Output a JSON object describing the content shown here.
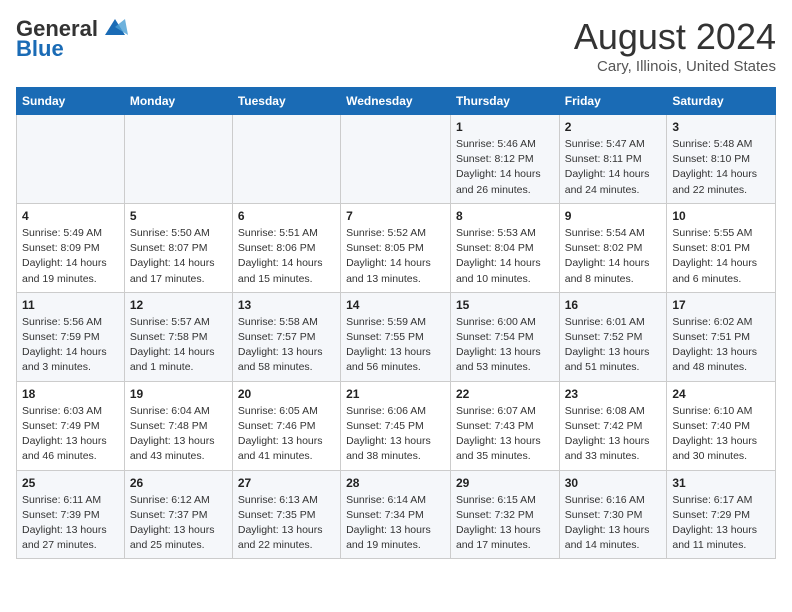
{
  "header": {
    "logo_line1": "General",
    "logo_line2": "Blue",
    "month": "August 2024",
    "location": "Cary, Illinois, United States"
  },
  "weekdays": [
    "Sunday",
    "Monday",
    "Tuesday",
    "Wednesday",
    "Thursday",
    "Friday",
    "Saturday"
  ],
  "weeks": [
    [
      {
        "day": "",
        "info": ""
      },
      {
        "day": "",
        "info": ""
      },
      {
        "day": "",
        "info": ""
      },
      {
        "day": "",
        "info": ""
      },
      {
        "day": "1",
        "info": "Sunrise: 5:46 AM\nSunset: 8:12 PM\nDaylight: 14 hours\nand 26 minutes."
      },
      {
        "day": "2",
        "info": "Sunrise: 5:47 AM\nSunset: 8:11 PM\nDaylight: 14 hours\nand 24 minutes."
      },
      {
        "day": "3",
        "info": "Sunrise: 5:48 AM\nSunset: 8:10 PM\nDaylight: 14 hours\nand 22 minutes."
      }
    ],
    [
      {
        "day": "4",
        "info": "Sunrise: 5:49 AM\nSunset: 8:09 PM\nDaylight: 14 hours\nand 19 minutes."
      },
      {
        "day": "5",
        "info": "Sunrise: 5:50 AM\nSunset: 8:07 PM\nDaylight: 14 hours\nand 17 minutes."
      },
      {
        "day": "6",
        "info": "Sunrise: 5:51 AM\nSunset: 8:06 PM\nDaylight: 14 hours\nand 15 minutes."
      },
      {
        "day": "7",
        "info": "Sunrise: 5:52 AM\nSunset: 8:05 PM\nDaylight: 14 hours\nand 13 minutes."
      },
      {
        "day": "8",
        "info": "Sunrise: 5:53 AM\nSunset: 8:04 PM\nDaylight: 14 hours\nand 10 minutes."
      },
      {
        "day": "9",
        "info": "Sunrise: 5:54 AM\nSunset: 8:02 PM\nDaylight: 14 hours\nand 8 minutes."
      },
      {
        "day": "10",
        "info": "Sunrise: 5:55 AM\nSunset: 8:01 PM\nDaylight: 14 hours\nand 6 minutes."
      }
    ],
    [
      {
        "day": "11",
        "info": "Sunrise: 5:56 AM\nSunset: 7:59 PM\nDaylight: 14 hours\nand 3 minutes."
      },
      {
        "day": "12",
        "info": "Sunrise: 5:57 AM\nSunset: 7:58 PM\nDaylight: 14 hours\nand 1 minute."
      },
      {
        "day": "13",
        "info": "Sunrise: 5:58 AM\nSunset: 7:57 PM\nDaylight: 13 hours\nand 58 minutes."
      },
      {
        "day": "14",
        "info": "Sunrise: 5:59 AM\nSunset: 7:55 PM\nDaylight: 13 hours\nand 56 minutes."
      },
      {
        "day": "15",
        "info": "Sunrise: 6:00 AM\nSunset: 7:54 PM\nDaylight: 13 hours\nand 53 minutes."
      },
      {
        "day": "16",
        "info": "Sunrise: 6:01 AM\nSunset: 7:52 PM\nDaylight: 13 hours\nand 51 minutes."
      },
      {
        "day": "17",
        "info": "Sunrise: 6:02 AM\nSunset: 7:51 PM\nDaylight: 13 hours\nand 48 minutes."
      }
    ],
    [
      {
        "day": "18",
        "info": "Sunrise: 6:03 AM\nSunset: 7:49 PM\nDaylight: 13 hours\nand 46 minutes."
      },
      {
        "day": "19",
        "info": "Sunrise: 6:04 AM\nSunset: 7:48 PM\nDaylight: 13 hours\nand 43 minutes."
      },
      {
        "day": "20",
        "info": "Sunrise: 6:05 AM\nSunset: 7:46 PM\nDaylight: 13 hours\nand 41 minutes."
      },
      {
        "day": "21",
        "info": "Sunrise: 6:06 AM\nSunset: 7:45 PM\nDaylight: 13 hours\nand 38 minutes."
      },
      {
        "day": "22",
        "info": "Sunrise: 6:07 AM\nSunset: 7:43 PM\nDaylight: 13 hours\nand 35 minutes."
      },
      {
        "day": "23",
        "info": "Sunrise: 6:08 AM\nSunset: 7:42 PM\nDaylight: 13 hours\nand 33 minutes."
      },
      {
        "day": "24",
        "info": "Sunrise: 6:10 AM\nSunset: 7:40 PM\nDaylight: 13 hours\nand 30 minutes."
      }
    ],
    [
      {
        "day": "25",
        "info": "Sunrise: 6:11 AM\nSunset: 7:39 PM\nDaylight: 13 hours\nand 27 minutes."
      },
      {
        "day": "26",
        "info": "Sunrise: 6:12 AM\nSunset: 7:37 PM\nDaylight: 13 hours\nand 25 minutes."
      },
      {
        "day": "27",
        "info": "Sunrise: 6:13 AM\nSunset: 7:35 PM\nDaylight: 13 hours\nand 22 minutes."
      },
      {
        "day": "28",
        "info": "Sunrise: 6:14 AM\nSunset: 7:34 PM\nDaylight: 13 hours\nand 19 minutes."
      },
      {
        "day": "29",
        "info": "Sunrise: 6:15 AM\nSunset: 7:32 PM\nDaylight: 13 hours\nand 17 minutes."
      },
      {
        "day": "30",
        "info": "Sunrise: 6:16 AM\nSunset: 7:30 PM\nDaylight: 13 hours\nand 14 minutes."
      },
      {
        "day": "31",
        "info": "Sunrise: 6:17 AM\nSunset: 7:29 PM\nDaylight: 13 hours\nand 11 minutes."
      }
    ]
  ]
}
